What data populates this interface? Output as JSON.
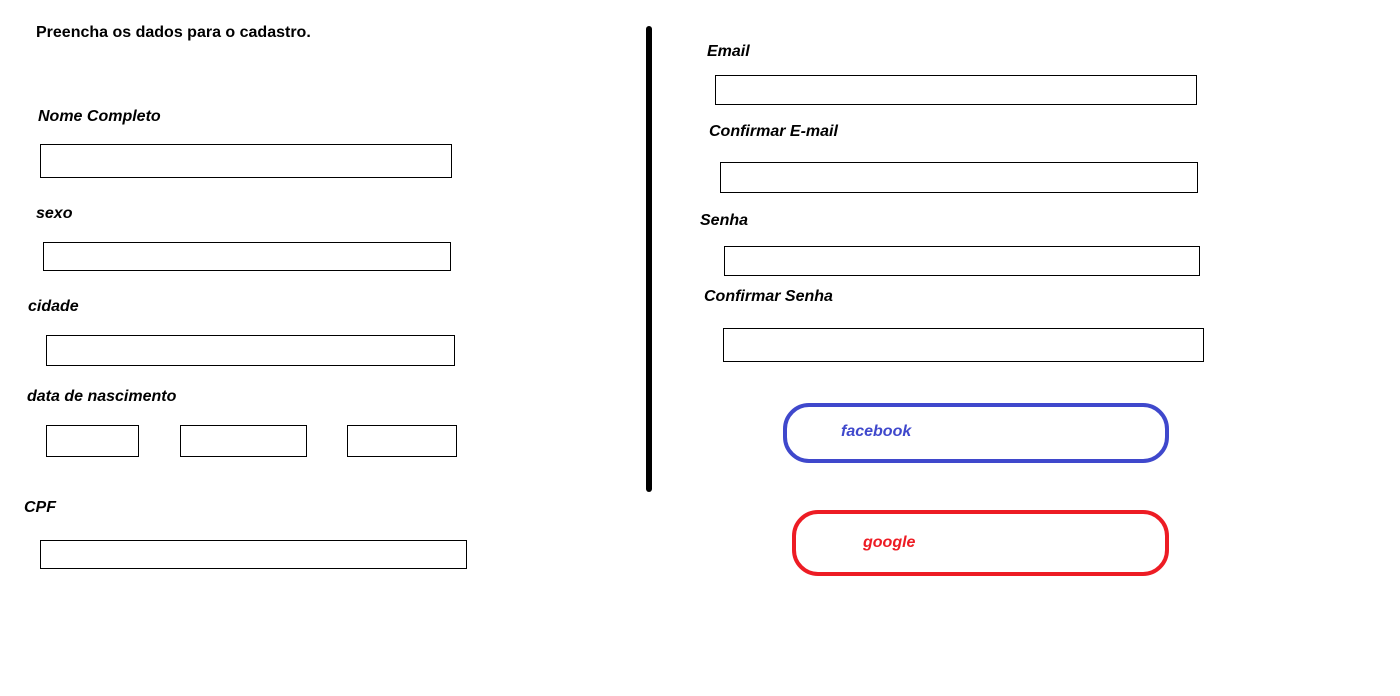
{
  "form": {
    "instruction": "Preencha os dados para o cadastro.",
    "fields": {
      "nome_completo": {
        "label": "Nome Completo",
        "value": ""
      },
      "sexo": {
        "label": "sexo",
        "value": ""
      },
      "cidade": {
        "label": "cidade",
        "value": ""
      },
      "data_nascimento": {
        "label": "data de nascimento",
        "day": "",
        "month": "",
        "year": ""
      },
      "cpf": {
        "label": "CPF",
        "value": ""
      },
      "email": {
        "label": "Email",
        "value": ""
      },
      "confirmar_email": {
        "label": "Confirmar E-mail",
        "value": ""
      },
      "senha": {
        "label": "Senha",
        "value": ""
      },
      "confirmar_senha": {
        "label": "Confirmar Senha",
        "value": ""
      }
    }
  },
  "social": {
    "facebook": {
      "label": "facebook",
      "color": "#3f48cc"
    },
    "google": {
      "label": "google",
      "color": "#ed1c24"
    }
  }
}
